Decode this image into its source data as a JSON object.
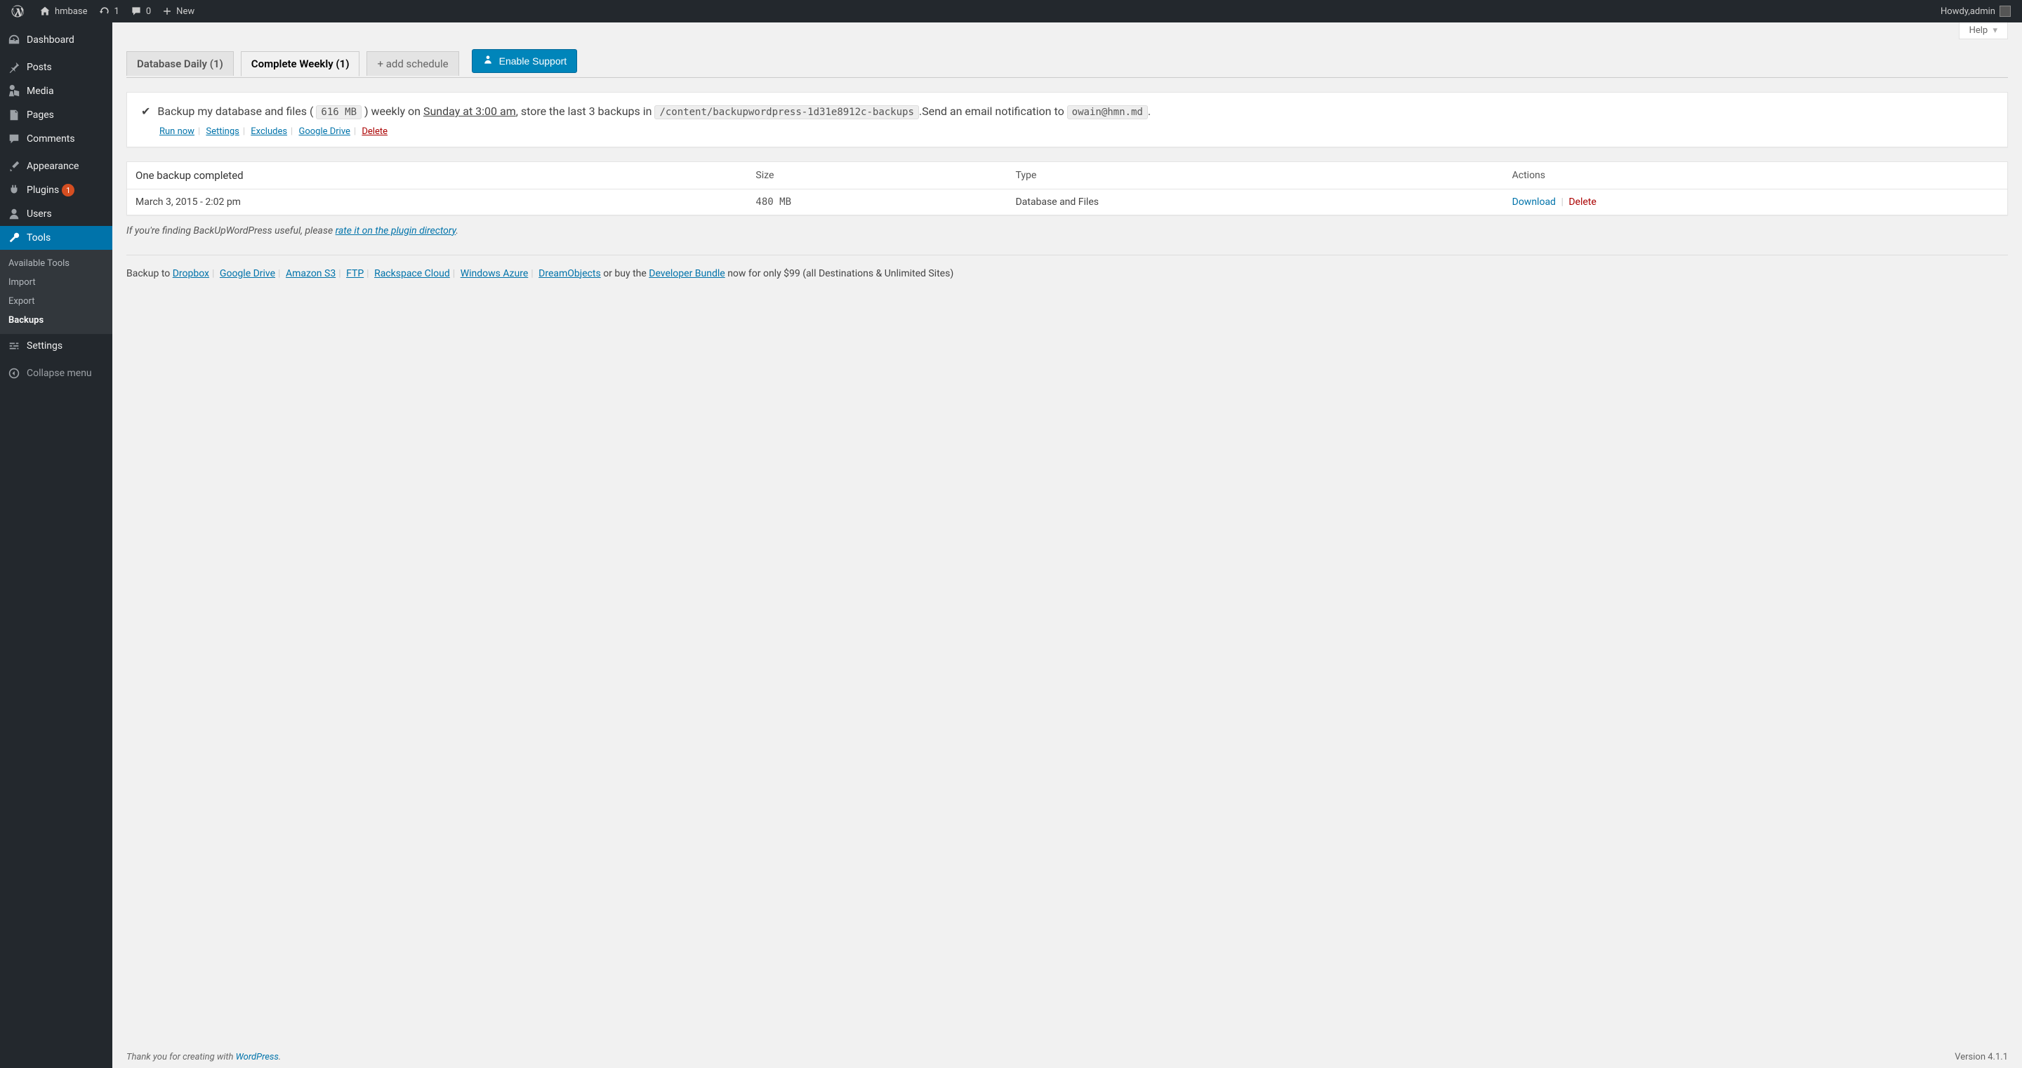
{
  "adminbar": {
    "site_name": "hmbase",
    "refresh_count": "1",
    "comments_count": "0",
    "new_label": "New",
    "howdy_prefix": "Howdy, ",
    "user_name": "admin"
  },
  "sidebar": {
    "items": [
      {
        "label": "Dashboard"
      },
      {
        "label": "Posts"
      },
      {
        "label": "Media"
      },
      {
        "label": "Pages"
      },
      {
        "label": "Comments"
      },
      {
        "label": "Appearance"
      },
      {
        "label": "Plugins",
        "badge": "1"
      },
      {
        "label": "Users"
      },
      {
        "label": "Tools"
      },
      {
        "label": "Settings"
      }
    ],
    "submenu": {
      "items": [
        {
          "label": "Available Tools"
        },
        {
          "label": "Import"
        },
        {
          "label": "Export"
        },
        {
          "label": "Backups"
        }
      ]
    },
    "collapse_label": "Collapse menu"
  },
  "help": {
    "label": "Help"
  },
  "tabs": {
    "items": [
      {
        "label": "Database Daily (1)"
      },
      {
        "label": "Complete Weekly (1)"
      },
      {
        "label": "+ add schedule"
      }
    ],
    "enable_support": "Enable Support"
  },
  "notice": {
    "pre": "Backup my database and files ( ",
    "size_code": "616 MB",
    "mid1": " ) weekly on ",
    "schedule_link": "Sunday at 3:00 am",
    "mid2": ", store the last 3 backups in ",
    "path_code": "/content/backupwordpress-1d31e8912c-backups",
    "mid3": ".Send an email notification to ",
    "email_code": "owain@hmn.md",
    "end": ".",
    "links": {
      "run_now": "Run now",
      "settings": "Settings",
      "excludes": "Excludes",
      "google_drive": "Google Drive",
      "delete": "Delete"
    }
  },
  "table": {
    "summary": "One backup completed",
    "headers": {
      "size": "Size",
      "type": "Type",
      "actions": "Actions"
    },
    "rows": [
      {
        "date": "March 3, 2015 - 2:02 pm",
        "size": "480 MB",
        "type": "Database and Files",
        "download": "Download",
        "delete": "Delete"
      }
    ]
  },
  "rate": {
    "pre": "If you're finding BackUpWordPress useful, please ",
    "link": "rate it on the plugin directory",
    "post": "."
  },
  "destinations": {
    "pre": "Backup to  ",
    "items": [
      "Dropbox",
      "Google Drive",
      "Amazon S3",
      "FTP",
      "Rackspace Cloud",
      "Windows Azure",
      "DreamObjects"
    ],
    "mid": "   or buy the ",
    "dev_bundle": "Developer Bundle",
    "post": " now for only $99 (all Destinations & Unlimited Sites)"
  },
  "footer": {
    "thanks_pre": "Thank you for creating with ",
    "wordpress": "WordPress",
    "thanks_post": ".",
    "version": "Version 4.1.1"
  }
}
